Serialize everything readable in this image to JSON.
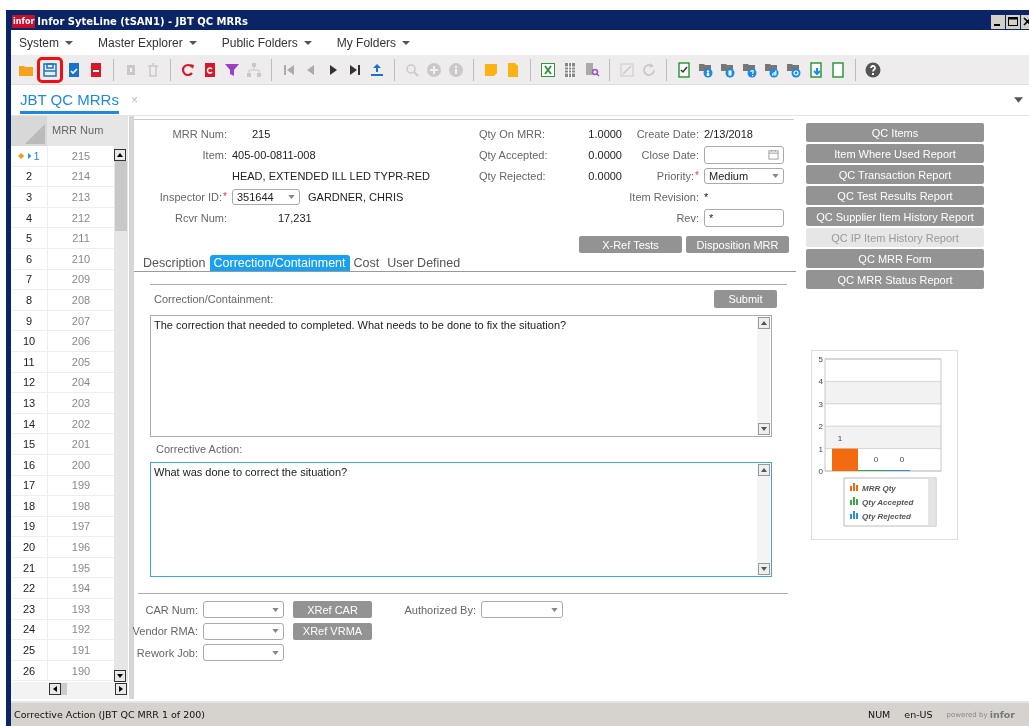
{
  "window": {
    "logo": "infor",
    "title": "Infor SyteLine (tSAN1) - JBT QC MRRs"
  },
  "menu": [
    {
      "label": "System"
    },
    {
      "label": "Master Explorer"
    },
    {
      "label": "Public Folders"
    },
    {
      "label": "My Folders"
    }
  ],
  "toolbar": [
    [
      {
        "kind": "folder",
        "disabled": false,
        "highlighted": false
      },
      {
        "kind": "save",
        "disabled": false,
        "highlighted": true
      },
      {
        "kind": "save-check",
        "disabled": false,
        "highlighted": false
      },
      {
        "kind": "delete",
        "disabled": false,
        "highlighted": false
      }
    ],
    [
      {
        "kind": "copy",
        "disabled": true,
        "highlighted": false
      },
      {
        "kind": "trash",
        "disabled": true,
        "highlighted": false
      }
    ],
    [
      {
        "kind": "refresh",
        "disabled": false,
        "highlighted": false
      },
      {
        "kind": "doc-refresh",
        "disabled": false,
        "highlighted": false
      },
      {
        "kind": "filter",
        "disabled": false,
        "highlighted": false
      },
      {
        "kind": "hierarchy",
        "disabled": true,
        "highlighted": false
      }
    ],
    [
      {
        "kind": "first",
        "disabled": true,
        "highlighted": false
      },
      {
        "kind": "prev",
        "disabled": true,
        "highlighted": false
      },
      {
        "kind": "next",
        "disabled": false,
        "highlighted": false
      },
      {
        "kind": "last",
        "disabled": false,
        "highlighted": false
      },
      {
        "kind": "upload",
        "disabled": false,
        "highlighted": false
      }
    ],
    [
      {
        "kind": "search",
        "disabled": true,
        "highlighted": false
      },
      {
        "kind": "add",
        "disabled": true,
        "highlighted": false
      },
      {
        "kind": "info",
        "disabled": true,
        "highlighted": false
      }
    ],
    [
      {
        "kind": "note",
        "disabled": false,
        "highlighted": false
      },
      {
        "kind": "doc",
        "disabled": false,
        "highlighted": false
      }
    ],
    [
      {
        "kind": "excel",
        "disabled": false,
        "highlighted": false
      },
      {
        "kind": "grid",
        "disabled": false,
        "highlighted": false
      },
      {
        "kind": "doc-search",
        "disabled": false,
        "highlighted": false
      }
    ],
    [
      {
        "kind": "edit",
        "disabled": true,
        "highlighted": false
      },
      {
        "kind": "reload",
        "disabled": true,
        "highlighted": false
      }
    ],
    [
      {
        "kind": "doc-check",
        "disabled": false,
        "highlighted": false
      },
      {
        "kind": "folder-person",
        "disabled": false,
        "highlighted": false
      },
      {
        "kind": "folder-doc",
        "disabled": false,
        "highlighted": false
      },
      {
        "kind": "folder-help",
        "disabled": false,
        "highlighted": false
      },
      {
        "kind": "folder-chart",
        "disabled": false,
        "highlighted": false
      },
      {
        "kind": "folder-target",
        "disabled": false,
        "highlighted": false
      },
      {
        "kind": "doc-down",
        "disabled": false,
        "highlighted": false
      },
      {
        "kind": "doc-blank",
        "disabled": false,
        "highlighted": false
      }
    ],
    [
      {
        "kind": "help",
        "disabled": false,
        "highlighted": false
      }
    ]
  ],
  "document_tab": {
    "label": "JBT QC MRRs",
    "close": "×",
    "selected": true
  },
  "grid": {
    "column": "MRR Num",
    "rows": [
      {
        "number": "1",
        "mrr_num": "215",
        "selected": true
      },
      {
        "number": "2",
        "mrr_num": "214",
        "selected": false
      },
      {
        "number": "3",
        "mrr_num": "213",
        "selected": false
      },
      {
        "number": "4",
        "mrr_num": "212",
        "selected": false
      },
      {
        "number": "5",
        "mrr_num": "211",
        "selected": false
      },
      {
        "number": "6",
        "mrr_num": "210",
        "selected": false
      },
      {
        "number": "7",
        "mrr_num": "209",
        "selected": false
      },
      {
        "number": "8",
        "mrr_num": "208",
        "selected": false
      },
      {
        "number": "9",
        "mrr_num": "207",
        "selected": false
      },
      {
        "number": "10",
        "mrr_num": "206",
        "selected": false
      },
      {
        "number": "11",
        "mrr_num": "205",
        "selected": false
      },
      {
        "number": "12",
        "mrr_num": "204",
        "selected": false
      },
      {
        "number": "13",
        "mrr_num": "203",
        "selected": false
      },
      {
        "number": "14",
        "mrr_num": "202",
        "selected": false
      },
      {
        "number": "15",
        "mrr_num": "201",
        "selected": false
      },
      {
        "number": "16",
        "mrr_num": "200",
        "selected": false
      },
      {
        "number": "17",
        "mrr_num": "199",
        "selected": false
      },
      {
        "number": "18",
        "mrr_num": "198",
        "selected": false
      },
      {
        "number": "19",
        "mrr_num": "197",
        "selected": false
      },
      {
        "number": "20",
        "mrr_num": "196",
        "selected": false
      },
      {
        "number": "21",
        "mrr_num": "195",
        "selected": false
      },
      {
        "number": "22",
        "mrr_num": "194",
        "selected": false
      },
      {
        "number": "23",
        "mrr_num": "193",
        "selected": false
      },
      {
        "number": "24",
        "mrr_num": "192",
        "selected": false
      },
      {
        "number": "25",
        "mrr_num": "191",
        "selected": false
      },
      {
        "number": "26",
        "mrr_num": "190",
        "selected": false
      }
    ]
  },
  "header": {
    "mrr_num": {
      "label": "MRR Num:",
      "value": "215"
    },
    "item": {
      "label": "Item:",
      "value": "405-00-0811-008",
      "description": "HEAD, EXTENDED ILL LED TYPR-RED"
    },
    "inspector": {
      "label": "Inspector ID:",
      "required": true,
      "value": "351644",
      "name": "GARDNER, CHRIS"
    },
    "rcvr_num": {
      "label": "Rcvr Num:",
      "value": "17,231"
    },
    "qty_on_mrr": {
      "label": "Qty On MRR:",
      "value": "1.0000"
    },
    "qty_accepted": {
      "label": "Qty Accepted:",
      "value": "0.0000"
    },
    "qty_rejected": {
      "label": "Qty Rejected:",
      "value": "0.0000"
    },
    "create_date": {
      "label": "Create Date:",
      "value": "2/13/2018"
    },
    "close_date": {
      "label": "Close Date:"
    },
    "priority": {
      "label": "Priority:",
      "required": true,
      "value": "Medium"
    },
    "item_revision": {
      "label": "Item Revision:",
      "value": "*"
    },
    "rev": {
      "label": "Rev:",
      "value": "*"
    }
  },
  "action_buttons": [
    "X-Ref Tests",
    "Disposition MRR"
  ],
  "subtabs": [
    {
      "label": "Description",
      "selected": false
    },
    {
      "label": "Correction/Containment",
      "selected": true
    },
    {
      "label": "Cost",
      "selected": false
    },
    {
      "label": "User Defined",
      "selected": false
    }
  ],
  "correction": {
    "label": "Correction/Containment:",
    "submit": "Submit",
    "text": "The correction that needed to completed. What needs to be done to fix the situation?",
    "focused": false
  },
  "corrective_action": {
    "label": "Corrective Action:",
    "text": "What was done to correct the situation?",
    "focused": true
  },
  "bottom": {
    "car_num": {
      "label": "CAR Num:",
      "button": "XRef CAR"
    },
    "vendor_rma": {
      "label": "Vendor RMA:",
      "button": "XRef VRMA"
    },
    "rework_job": {
      "label": "Rework Job:"
    },
    "authorized_by": {
      "label": "Authorized By:"
    }
  },
  "reports": [
    {
      "label": "QC Items",
      "disabled": false
    },
    {
      "label": "Item Where Used Report",
      "disabled": false
    },
    {
      "label": "QC Transaction Report",
      "disabled": false
    },
    {
      "label": "QC Test Results Report",
      "disabled": false
    },
    {
      "label": "QC Supplier Item History Report",
      "disabled": false
    },
    {
      "label": "QC IP Item History Report",
      "disabled": true
    },
    {
      "label": "QC MRR Form",
      "disabled": false
    },
    {
      "label": "QC MRR Status Report",
      "disabled": false
    }
  ],
  "chart": {
    "chart_data": {
      "type": "bar",
      "grid": true,
      "legend": true,
      "ylim": [
        0,
        5
      ],
      "yticks": [
        {
          "value": 0,
          "label": "0"
        },
        {
          "value": 1,
          "label": "1"
        },
        {
          "value": 2,
          "label": "2"
        },
        {
          "value": 3,
          "label": "3"
        },
        {
          "value": 4,
          "label": "4"
        },
        {
          "value": 5,
          "label": "5"
        }
      ],
      "data_labels": true,
      "series": [
        {
          "name": "MRR Qty",
          "color": "#f26b10",
          "values": [
            1
          ]
        },
        {
          "name": "Qty Accepted",
          "color": "#3aa845",
          "values": [
            0
          ]
        },
        {
          "name": "Qty Rejected",
          "color": "#2f8fdc",
          "values": [
            0
          ]
        }
      ]
    }
  },
  "status_bar": {
    "message": "Corrective Action (JBT QC MRR 1 of 200)",
    "num": "NUM",
    "locale": "en-US",
    "powered_by": "powered by",
    "brand": "infor"
  }
}
